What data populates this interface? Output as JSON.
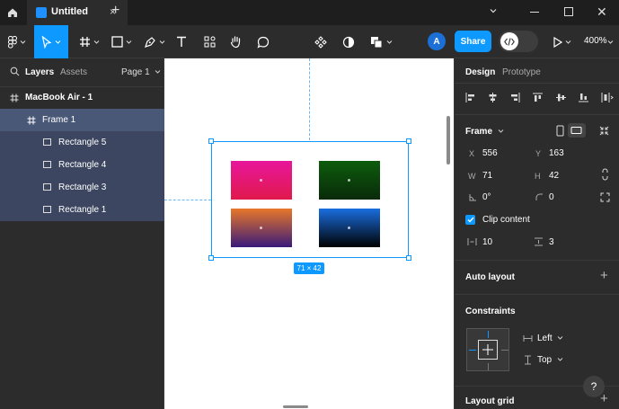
{
  "titlebar": {
    "tab_title": "Untitled",
    "tab_close": "×",
    "new_tab": "+",
    "close_window": "✕"
  },
  "toolbar": {
    "avatar_initial": "A",
    "share_label": "Share",
    "zoom_level": "400%"
  },
  "left_panel": {
    "tabs": [
      "Layers",
      "Assets"
    ],
    "page_selector": "Page 1",
    "layers": [
      {
        "label": "MacBook Air - 1",
        "type": "frame"
      },
      {
        "label": "Frame 1",
        "type": "frame"
      },
      {
        "label": "Rectangle 5",
        "type": "rect"
      },
      {
        "label": "Rectangle 4",
        "type": "rect"
      },
      {
        "label": "Rectangle 3",
        "type": "rect"
      },
      {
        "label": "Rectangle 1",
        "type": "rect"
      }
    ]
  },
  "canvas": {
    "size_badge": "71 × 42",
    "rectangles": [
      {
        "name": "rect-pink",
        "from": "#e8169b",
        "to": "#e0194c"
      },
      {
        "name": "rect-green",
        "from": "#0c5c0c",
        "to": "#0a2a0a"
      },
      {
        "name": "rect-orange",
        "from": "#e8772a",
        "to": "#3a1a7a"
      },
      {
        "name": "rect-blue",
        "from": "#1a6ee0",
        "to": "#000000"
      }
    ]
  },
  "right_panel": {
    "tabs": [
      "Design",
      "Prototype"
    ],
    "frame_label": "Frame",
    "x_label": "X",
    "x_value": "556",
    "y_label": "Y",
    "y_value": "163",
    "w_label": "W",
    "w_value": "71",
    "h_label": "H",
    "h_value": "42",
    "rotation_value": "0°",
    "radius_value": "0",
    "clip_content_label": "Clip content",
    "spacing_value": "10",
    "padding_value": "3",
    "auto_layout_title": "Auto layout",
    "constraints_title": "Constraints",
    "horizontal_constraint": "Left",
    "vertical_constraint": "Top",
    "layout_grid_title": "Layout grid",
    "help_label": "?"
  },
  "colors": {
    "accent": "#0d99ff",
    "panel_bg": "#2c2c2c",
    "titlebar_bg": "#1e1e1e",
    "selected_layer": "#4a5878"
  }
}
